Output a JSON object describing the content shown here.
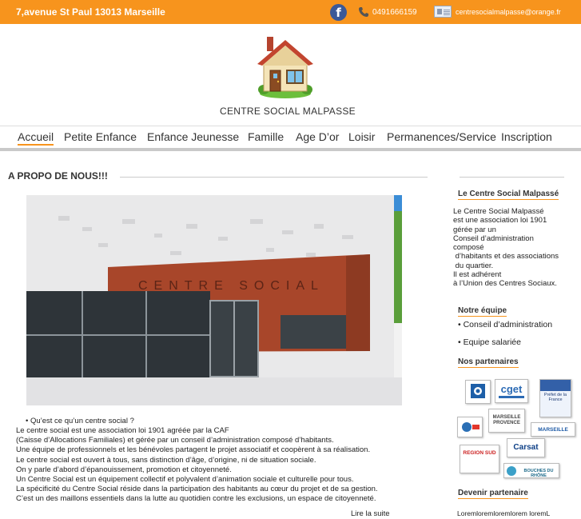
{
  "topbar": {
    "address": "7,avenue St Paul 13013 Marseille",
    "facebook_icon": "facebook-icon",
    "phone_icon": "phone-icon",
    "phone": "0491666159",
    "mail_icon": "mail-icon",
    "email": "centresocialmalpasse@orange.fr",
    "bg_color": "#f7941d"
  },
  "brand": {
    "logo_icon": "house-icon",
    "name": "CENTRE SOCIAL MALPASSE"
  },
  "nav": {
    "items": [
      {
        "label": "Accueil",
        "active": true
      },
      {
        "label": "Petite Enfance"
      },
      {
        "label": "Enfance  Jeunesse"
      },
      {
        "label": "Famille"
      },
      {
        "label": "Age D’or"
      },
      {
        "label": "Loisir"
      },
      {
        "label": "Permanences/Service"
      },
      {
        "label": "Inscription"
      }
    ],
    "accent_color": "#f7941d"
  },
  "main": {
    "title": "A PROPO DE NOUS!!!",
    "photo_sign": "CENTRE SOCIAL",
    "bullet": "• Qu’est ce qu’un centre social ?",
    "lines": [
      "Le centre social est une association loi 1901 agréée par la CAF",
      "(Caisse d’Allocations Familiales) et gérée par un conseil d’administration composé d’habitants.",
      " Une équipe de professionnels et les bénévoles partagent le projet associatif et coopèrent à sa réalisation.",
      "Le centre social est ouvert à tous, sans distinction d’âge, d’origine, ni de situation sociale.",
      "On y parle d’abord d’épanouissement, promotion et citoyenneté.",
      "Un Centre Social est un équipement collectif et polyvalent d’animation sociale et culturelle pour tous.",
      "La spécificité du Centre Social réside dans la participation des habitants au cœur du projet et de sa gestion.",
      " C’est un des maillons essentiels dans la lutte au quotidien contre les exclusions, un espace de citoyenneté."
    ],
    "read_more": "Lire la suite"
  },
  "sidebar": {
    "about_heading": "Le Centre Social Malpassé",
    "about_text": "Le Centre Social Malpassé\nest une association loi 1901\ngérée par un\nConseil d’administration\ncomposé\n d’habitants et des associations\n du quartier.\nIl est adhérent\nà l’Union des Centres Sociaux.",
    "team_heading": "Notre équipe",
    "team_items": [
      "• Conseil d’administration",
      "• Equipe salariée"
    ],
    "partners_heading": "Nos partenaires",
    "partner_logos": {
      "cget": "cget",
      "prefet": "Préfet de la France",
      "marseille": "MARSEILLE PROVENCE",
      "ville": "MARSEILLE",
      "region": "REGION SUD",
      "carsat": "Carsat",
      "bouches": "BOUCHES DU RHÔNE"
    },
    "become_partner_heading": "Devenir partenaire",
    "lorem": "Loremloremloremlorem loremL"
  }
}
